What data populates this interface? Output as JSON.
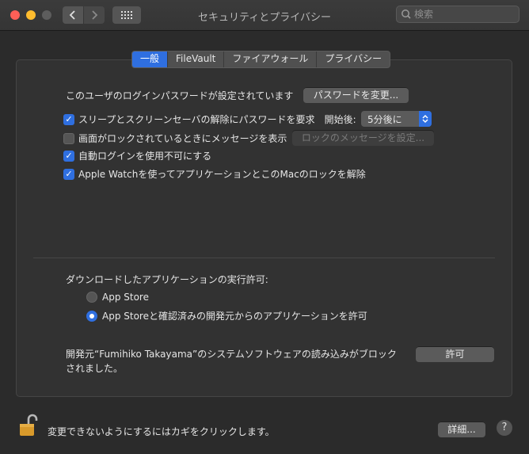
{
  "window": {
    "title": "セキュリティとプライバシー",
    "search_placeholder": "検索"
  },
  "tabs": [
    {
      "label": "一般",
      "active": true
    },
    {
      "label": "FileVault",
      "active": false
    },
    {
      "label": "ファイアウォール",
      "active": false
    },
    {
      "label": "プライバシー",
      "active": false
    }
  ],
  "general": {
    "password_text": "このユーザのログインパスワードが設定されています",
    "change_password_button": "パスワードを変更...",
    "require_password_label": "スリープとスクリーンセーバの解除にパスワードを要求",
    "require_password_checked": true,
    "start_after_label": "開始後:",
    "start_after_value": "5分後に",
    "lock_message_label": "画面がロックされているときにメッセージを表示",
    "lock_message_checked": false,
    "set_lock_message_button": "ロックのメッセージを設定...",
    "disable_autologin_label": "自動ログインを使用不可にする",
    "disable_autologin_checked": true,
    "apple_watch_label": "Apple Watchを使ってアプリケーションとこのMacのロックを解除",
    "apple_watch_checked": true
  },
  "downloads": {
    "heading": "ダウンロードしたアプリケーションの実行許可:",
    "options": [
      {
        "label": "App Store",
        "selected": false
      },
      {
        "label": "App Storeと確認済みの開発元からのアプリケーションを許可",
        "selected": true
      }
    ],
    "blocked_line1": "開発元“Fumihiko Takayama”のシステムソフトウェアの読み込みがブロック",
    "blocked_line2": "されました。",
    "allow_button": "許可"
  },
  "footer": {
    "lock_text": "変更できないようにするにはカギをクリックします。",
    "advanced_button": "詳細...",
    "help_label": "?"
  },
  "colors": {
    "accent": "#2f6fe0",
    "background": "#2b2b2b",
    "panel": "#323232"
  }
}
